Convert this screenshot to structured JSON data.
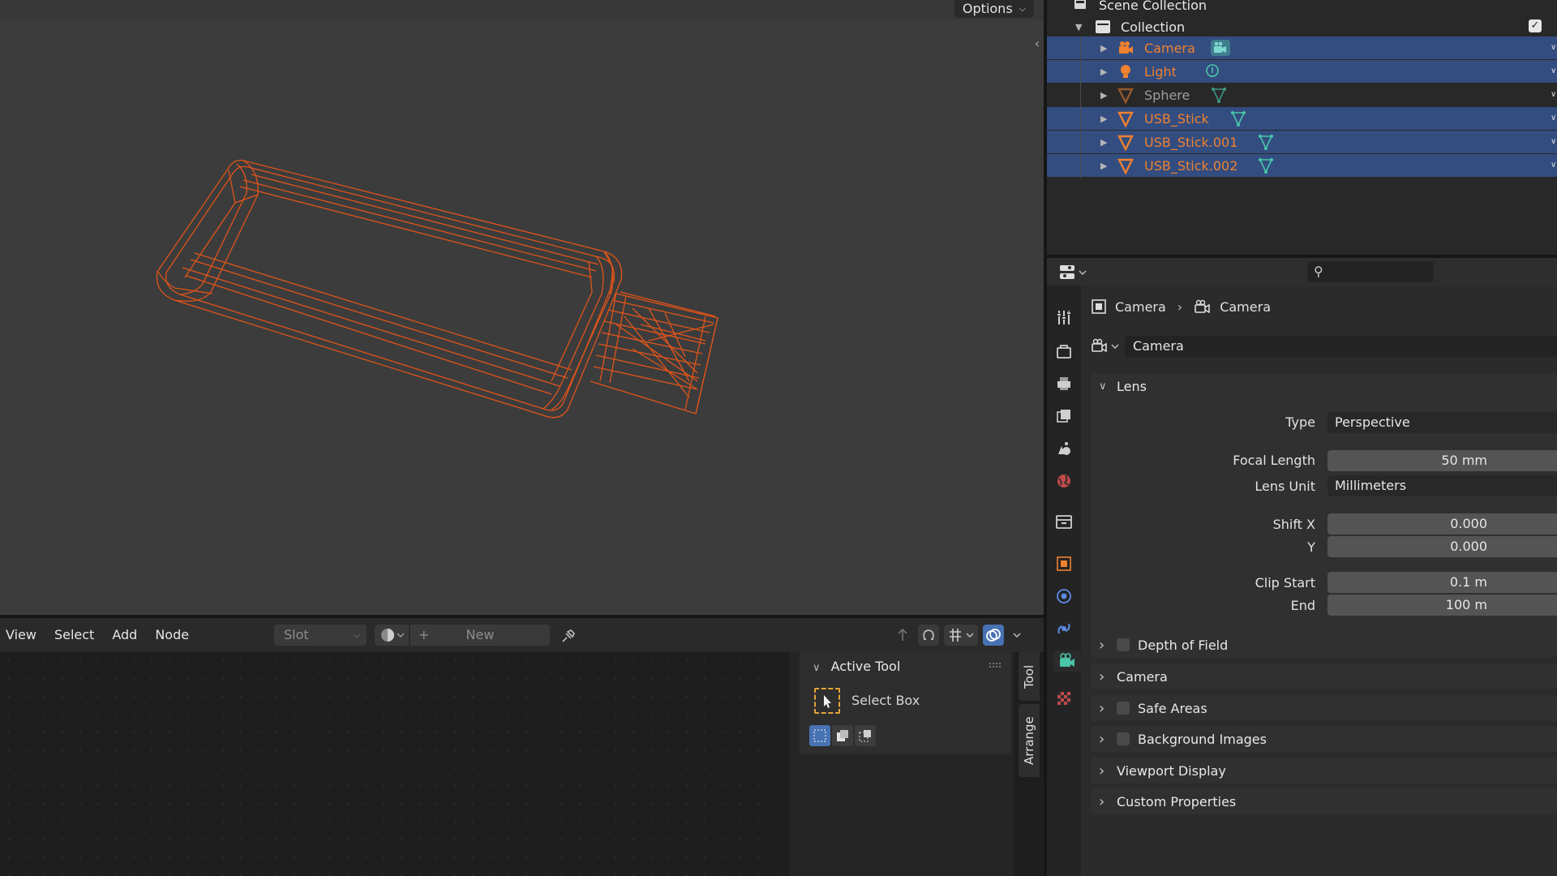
{
  "viewport": {
    "options_label": "Options"
  },
  "node_editor": {
    "menu": [
      "View",
      "Select",
      "Add",
      "Node"
    ],
    "slot_placeholder": "Slot",
    "new_label": "New",
    "active_tool": {
      "title": "Active Tool",
      "tool_name": "Select Box"
    },
    "tabs": [
      "Tool",
      "Arrange"
    ]
  },
  "outliner": {
    "scene_collection": "Scene Collection",
    "collection": "Collection",
    "objects": [
      {
        "name": "Camera",
        "icon": "camera-object-icon",
        "data_icon": "camera-data-icon",
        "selected": true,
        "dim": false
      },
      {
        "name": "Light",
        "icon": "light-object-icon",
        "data_icon": "light-data-icon",
        "selected": true,
        "dim": false
      },
      {
        "name": "Sphere",
        "icon": "mesh-object-icon",
        "data_icon": "mesh-data-icon",
        "selected": false,
        "dim": true
      },
      {
        "name": "USB_Stick",
        "icon": "mesh-object-icon",
        "data_icon": "mesh-data-icon",
        "selected": true,
        "dim": false
      },
      {
        "name": "USB_Stick.001",
        "icon": "mesh-object-icon",
        "data_icon": "mesh-data-icon",
        "selected": true,
        "dim": false
      },
      {
        "name": "USB_Stick.002",
        "icon": "mesh-object-icon",
        "data_icon": "mesh-data-icon",
        "selected": true,
        "dim": false
      }
    ]
  },
  "properties": {
    "breadcrumb": [
      "Camera",
      "Camera"
    ],
    "data_block_name": "Camera",
    "lens": {
      "title": "Lens",
      "type_label": "Type",
      "type_value": "Perspective",
      "focal_length_label": "Focal Length",
      "focal_length_value": "50 mm",
      "lens_unit_label": "Lens Unit",
      "lens_unit_value": "Millimeters",
      "shift_x_label": "Shift X",
      "shift_x_value": "0.000",
      "shift_y_label": "Y",
      "shift_y_value": "0.000",
      "clip_start_label": "Clip Start",
      "clip_start_value": "0.1 m",
      "clip_end_label": "End",
      "clip_end_value": "100 m"
    },
    "panels": [
      {
        "title": "Depth of Field",
        "checkbox": true
      },
      {
        "title": "Camera",
        "checkbox": false
      },
      {
        "title": "Safe Areas",
        "checkbox": true
      },
      {
        "title": "Background Images",
        "checkbox": true
      },
      {
        "title": "Viewport Display",
        "checkbox": false
      },
      {
        "title": "Custom Properties",
        "checkbox": false
      }
    ]
  },
  "colors": {
    "selection": "#334d80",
    "object_orange": "#f0812f",
    "wire": "#e0541a",
    "accent_blue": "#4772b3"
  }
}
